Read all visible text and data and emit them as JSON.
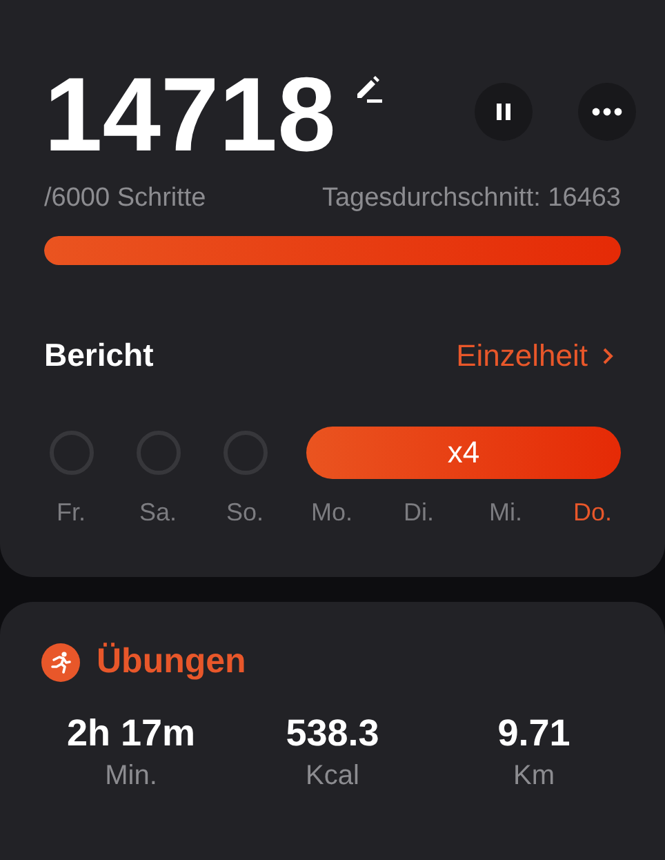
{
  "steps": {
    "count": "14718",
    "goal": "/6000 Schritte",
    "daily_average": "Tagesdurchschnitt: 16463",
    "level": 1
  },
  "report": {
    "title": "Bericht",
    "detail_link": "Einzelheit",
    "streak": "x4",
    "days": [
      {
        "label": "Fr.",
        "done": false,
        "selected": false
      },
      {
        "label": "Sa.",
        "done": false,
        "selected": false
      },
      {
        "label": "So.",
        "done": false,
        "selected": false
      },
      {
        "label": "Mo.",
        "done": true,
        "selected": false
      },
      {
        "label": "Di.",
        "done": true,
        "selected": false
      },
      {
        "label": "Mi.",
        "done": true,
        "selected": false
      },
      {
        "label": "Do.",
        "done": true,
        "selected": true
      }
    ]
  },
  "exercise": {
    "title": "Übungen",
    "stats": [
      {
        "value": "2h 17m",
        "unit": "Min."
      },
      {
        "value": "538.3",
        "unit": "Kcal"
      },
      {
        "value": "9.71",
        "unit": "Km"
      }
    ]
  }
}
